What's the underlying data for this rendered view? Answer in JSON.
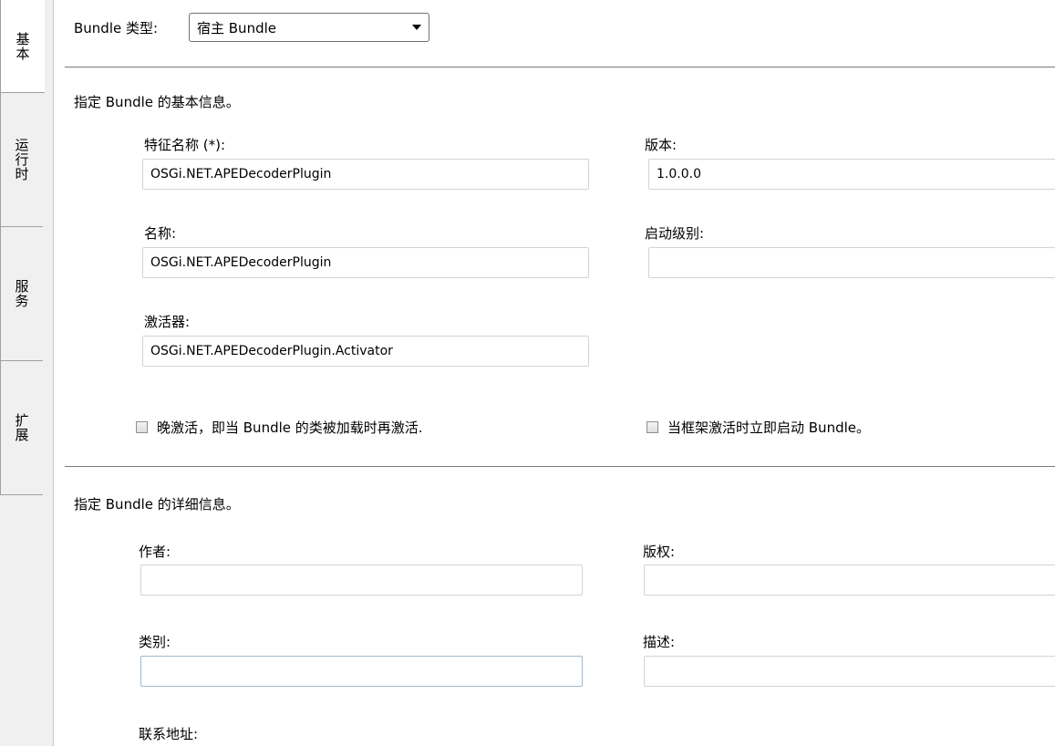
{
  "tabs": [
    {
      "label": "基本",
      "active": true
    },
    {
      "label": "运行时",
      "active": false
    },
    {
      "label": "服务",
      "active": false
    },
    {
      "label": "扩展",
      "active": false
    }
  ],
  "bundle_type": {
    "label": "Bundle 类型:",
    "value": "宿主 Bundle"
  },
  "basic": {
    "section_title": "指定 Bundle 的基本信息。",
    "symbolic_name": {
      "label": "特征名称 (*):",
      "value": "OSGi.NET.APEDecoderPlugin"
    },
    "version": {
      "label": "版本:",
      "value": "1.0.0.0"
    },
    "name": {
      "label": "名称:",
      "value": "OSGi.NET.APEDecoderPlugin"
    },
    "start_level": {
      "label": "启动级别:",
      "value": ""
    },
    "activator": {
      "label": "激活器:",
      "value": "OSGi.NET.APEDecoderPlugin.Activator"
    },
    "lazy_activation": {
      "label": "晚激活，即当 Bundle 的类被加载时再激活.",
      "checked": false
    },
    "start_on_framework": {
      "label": "当框架激活时立即启动 Bundle。",
      "checked": false
    }
  },
  "details": {
    "section_title": "指定 Bundle 的详细信息。",
    "author": {
      "label": "作者:",
      "value": ""
    },
    "copyright": {
      "label": "版权:",
      "value": ""
    },
    "category": {
      "label": "类别:",
      "value": ""
    },
    "description": {
      "label": "描述:",
      "value": ""
    },
    "contact": {
      "label": "联系地址:"
    }
  }
}
